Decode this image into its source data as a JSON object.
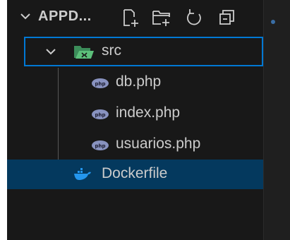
{
  "explorer": {
    "header": {
      "title": "APPD...",
      "icons": [
        "new-file-icon",
        "new-folder-icon",
        "refresh-icon",
        "collapse-all-icon"
      ]
    },
    "folder": {
      "name": "src",
      "expanded": true,
      "icon": "folder-open-icon"
    },
    "files": [
      {
        "name": "db.php",
        "icon": "php-icon"
      },
      {
        "name": "index.php",
        "icon": "php-icon"
      },
      {
        "name": "usuarios.php",
        "icon": "php-icon"
      }
    ],
    "root_files": [
      {
        "name": "Dockerfile",
        "icon": "docker-icon",
        "selected": true
      }
    ]
  },
  "colors": {
    "background": "#181818",
    "selection": "#04395e",
    "focus_border": "#0078d4",
    "text": "#cccccc",
    "php_icon": "#8892bf",
    "docker_icon": "#2496ed",
    "folder_icon": "#4fb26b"
  }
}
